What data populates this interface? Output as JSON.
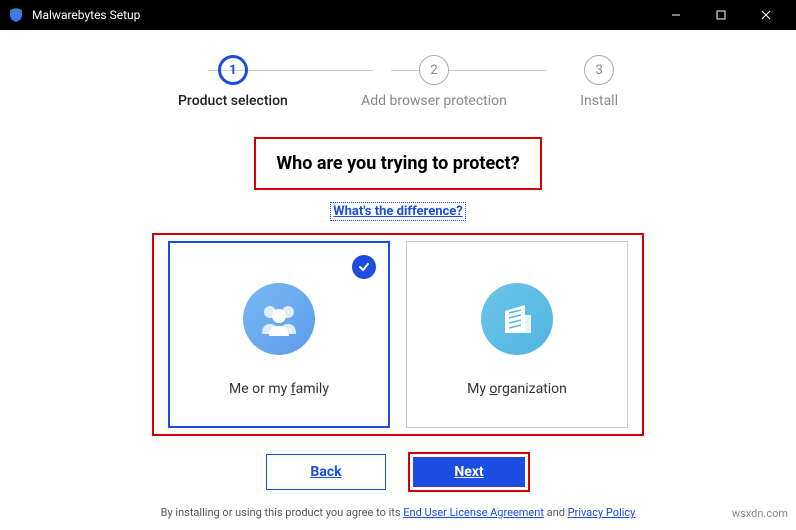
{
  "titlebar": {
    "title": "Malwarebytes Setup"
  },
  "stepper": {
    "step1": {
      "num": "1",
      "label": "Product selection"
    },
    "step2": {
      "num": "2",
      "label": "Add browser protection"
    },
    "step3": {
      "num": "3",
      "label": "Install"
    }
  },
  "heading": "Who are you trying to protect?",
  "diff_link": "What's the difference?",
  "cards": {
    "family": {
      "label_pre": "Me or my ",
      "label_u": "f",
      "label_post": "amily"
    },
    "org": {
      "label_pre": "My ",
      "label_u": "o",
      "label_post": "rganization"
    }
  },
  "buttons": {
    "back": "Back",
    "next": "Next"
  },
  "footer": {
    "pre": "By installing or using this product you agree to its ",
    "eula": "End User License Agreement",
    "mid": " and ",
    "privacy": "Privacy Policy"
  },
  "watermark": "wsxdn.com"
}
